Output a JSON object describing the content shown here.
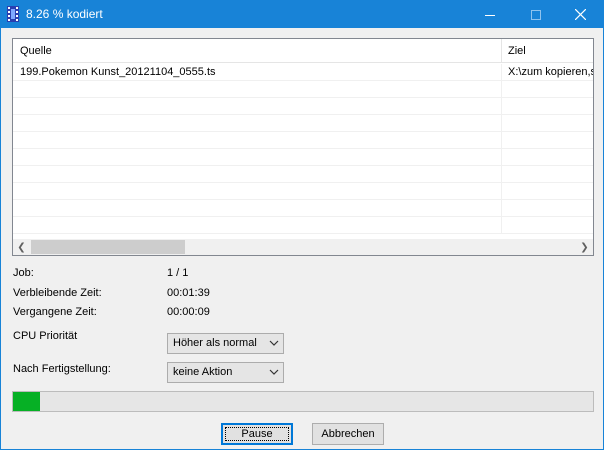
{
  "window": {
    "title": "8.26 % kodiert",
    "accent_color": "#1883d7",
    "icons": {
      "app": "film-icon",
      "minimize": "minimize-icon",
      "maximize": "maximize-icon",
      "close": "close-icon"
    }
  },
  "listview": {
    "columns": [
      "Quelle",
      "Ziel"
    ],
    "rows": [
      {
        "quelle": "199.Pokemon Kunst_20121104_0555.ts",
        "ziel": "X:\\zum kopieren,s"
      }
    ],
    "scrollbar": {
      "left_icon": "chevron-left-icon",
      "right_icon": "chevron-right-icon"
    }
  },
  "info": {
    "job_label": "Job:",
    "job_value": "1 / 1",
    "remaining_label": "Verbleibende Zeit:",
    "remaining_value": "00:01:39",
    "elapsed_label": "Vergangene Zeit:",
    "elapsed_value": "00:00:09"
  },
  "options": {
    "cpu_label": "CPU Priorität",
    "cpu_value": "Höher als normal",
    "after_label": "Nach Fertigstellung:",
    "after_value": "keine Aktion"
  },
  "progress": {
    "fraction": 0.0826,
    "color": "#06b025"
  },
  "buttons": {
    "pause": "Pause",
    "cancel": "Abbrechen"
  }
}
